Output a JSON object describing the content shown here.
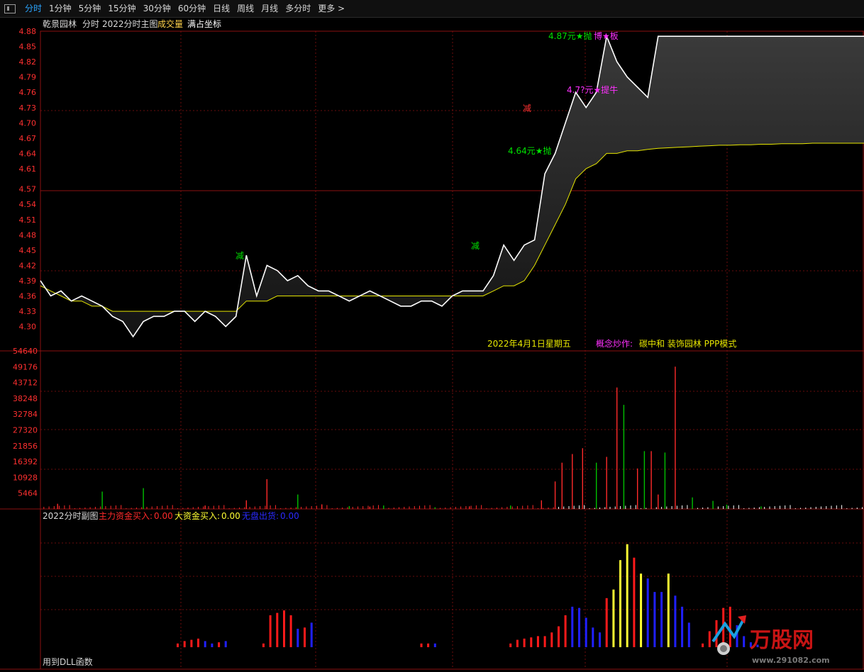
{
  "toolbar": {
    "menu_icon": "window-icon",
    "tabs": [
      "分时",
      "1分钟",
      "5分钟",
      "15分钟",
      "30分钟",
      "60分钟",
      "日线",
      "周线",
      "月线",
      "多分时",
      "更多 >"
    ],
    "active_index": 0
  },
  "chart_header": {
    "stock_name": "乾景园林",
    "period": "分时",
    "indicator": "2022分时主图",
    "volume_label": "成交量",
    "coord_mode": "满占坐标"
  },
  "annotations": {
    "date": "2022年4月1日星期五",
    "concept_label": "概念炒作:",
    "concept_text": "碳中和 装饰园林 PPP模式",
    "signals": [
      {
        "text": "减",
        "color": "#00e000"
      },
      {
        "text": "减",
        "color": "#00e000"
      },
      {
        "text": "4.64元★抛",
        "color": "#00e000"
      },
      {
        "text": "减",
        "color": "#ff3030"
      },
      {
        "text": "4.87元★抛",
        "color": "#00e000"
      },
      {
        "text": "博★板",
        "color": "#ff30ff"
      },
      {
        "text": "4.7?元★提牛",
        "color": "#ff30ff"
      }
    ]
  },
  "sub_chart": {
    "title": "2022分时副图",
    "main_in_label": "主力资金买入:",
    "main_in_value": "0.00",
    "big_in_label": "大资金买入:",
    "big_in_value": "0.00",
    "exit_label": "无盘出货:",
    "exit_value": "0.00",
    "footer": "用到DLL函数"
  },
  "watermark": {
    "brand": "万股网",
    "url": "www.291082.com"
  },
  "colors": {
    "up": "#ff2a2a",
    "down": "#00c000",
    "price": "#ffffff",
    "avg": "#e6e600",
    "grid": "#8a1010",
    "flat": "#ffffff",
    "yellow_bar": "#ffff33",
    "blue_bar": "#2020ff",
    "red_bar": "#ff1a1a"
  },
  "chart_data": [
    {
      "type": "line",
      "name": "price",
      "ylim": [
        4.28,
        4.88
      ],
      "yticks": [
        "4.88",
        "4.85",
        "4.82",
        "4.79",
        "4.76",
        "4.73",
        "4.70",
        "4.67",
        "4.64",
        "4.61",
        "4.57",
        "4.54",
        "4.51",
        "4.48",
        "4.45",
        "4.42",
        "4.39",
        "4.36",
        "4.33",
        "4.30"
      ],
      "x": [
        0,
        3,
        6,
        9,
        12,
        15,
        18,
        21,
        24,
        27,
        30,
        33,
        36,
        39,
        42,
        45,
        48,
        51,
        54,
        57,
        60,
        63,
        66,
        69,
        72,
        75,
        78,
        81,
        84,
        87,
        90,
        93,
        96,
        99,
        102,
        105,
        108,
        111,
        114,
        117,
        120,
        123,
        126,
        129,
        132,
        135,
        138,
        141,
        144,
        147,
        150,
        153,
        156,
        159,
        162,
        165,
        168,
        171,
        174,
        177,
        180,
        183,
        186,
        189,
        192,
        195,
        198,
        201,
        204,
        207,
        210,
        213,
        216,
        219,
        222,
        225,
        228,
        231,
        234,
        237,
        240
      ],
      "price": [
        4.39,
        4.36,
        4.37,
        4.35,
        4.36,
        4.35,
        4.34,
        4.32,
        4.31,
        4.28,
        4.31,
        4.32,
        4.32,
        4.33,
        4.33,
        4.31,
        4.33,
        4.32,
        4.3,
        4.32,
        4.44,
        4.36,
        4.42,
        4.41,
        4.39,
        4.4,
        4.38,
        4.37,
        4.37,
        4.36,
        4.35,
        4.36,
        4.37,
        4.36,
        4.35,
        4.34,
        4.34,
        4.35,
        4.35,
        4.34,
        4.36,
        4.37,
        4.37,
        4.37,
        4.4,
        4.46,
        4.43,
        4.46,
        4.47,
        4.6,
        4.64,
        4.7,
        4.76,
        4.73,
        4.76,
        4.87,
        4.82,
        4.79,
        4.77,
        4.75,
        4.87,
        4.87,
        4.87,
        4.87,
        4.87,
        4.87,
        4.87,
        4.87,
        4.87,
        4.87,
        4.87,
        4.87,
        4.87,
        4.87,
        4.87,
        4.87,
        4.87,
        4.87,
        4.87,
        4.87,
        4.87
      ],
      "avg": [
        4.38,
        4.37,
        4.36,
        4.35,
        4.35,
        4.34,
        4.34,
        4.33,
        4.33,
        4.33,
        4.33,
        4.33,
        4.33,
        4.33,
        4.33,
        4.33,
        4.33,
        4.33,
        4.33,
        4.33,
        4.35,
        4.35,
        4.35,
        4.36,
        4.36,
        4.36,
        4.36,
        4.36,
        4.36,
        4.36,
        4.36,
        4.36,
        4.36,
        4.36,
        4.36,
        4.36,
        4.36,
        4.36,
        4.36,
        4.36,
        4.36,
        4.36,
        4.36,
        4.36,
        4.37,
        4.38,
        4.38,
        4.39,
        4.42,
        4.46,
        4.5,
        4.54,
        4.59,
        4.61,
        4.62,
        4.64,
        4.64,
        4.645,
        4.645,
        4.648,
        4.65,
        4.651,
        4.652,
        4.653,
        4.654,
        4.655,
        4.656,
        4.656,
        4.657,
        4.657,
        4.658,
        4.658,
        4.659,
        4.659,
        4.659,
        4.66,
        4.66,
        4.66,
        4.66,
        4.66,
        4.66
      ]
    },
    {
      "type": "bar",
      "name": "volume",
      "ylim": [
        0,
        54640
      ],
      "yticks": [
        "54640",
        "49176",
        "43712",
        "38248",
        "32784",
        "27320",
        "21856",
        "16392",
        "10928",
        "5464"
      ],
      "x": [
        5,
        18,
        30,
        48,
        60,
        66,
        75,
        82,
        90,
        96,
        100,
        115,
        125,
        137,
        146,
        150,
        152,
        155,
        158,
        162,
        165,
        168,
        170,
        174,
        176,
        178,
        180,
        182,
        185,
        190,
        196,
        200,
        210
      ],
      "values": [
        1800,
        6000,
        7200,
        1200,
        3000,
        10300,
        5000,
        1600,
        1000,
        800,
        1200,
        600,
        900,
        1200,
        3000,
        9500,
        16000,
        19000,
        21000,
        16000,
        18000,
        42000,
        36000,
        14000,
        20000,
        20000,
        5000,
        19500,
        49200,
        4000,
        2800,
        1500,
        900
      ],
      "up": [
        true,
        false,
        false,
        true,
        true,
        true,
        false,
        true,
        false,
        true,
        false,
        false,
        true,
        false,
        true,
        true,
        true,
        true,
        true,
        false,
        true,
        true,
        false,
        true,
        false,
        true,
        true,
        false,
        true,
        false,
        false,
        false,
        false
      ]
    },
    {
      "type": "bar",
      "name": "2022分时副图",
      "x": [
        40,
        42,
        44,
        46,
        48,
        50,
        52,
        54,
        65,
        67,
        69,
        71,
        73,
        75,
        77,
        79,
        111,
        113,
        115,
        137,
        139,
        141,
        143,
        145,
        147,
        149,
        151,
        153,
        155,
        157,
        159,
        161,
        163,
        165,
        167,
        169,
        171,
        173,
        175,
        177,
        179,
        181,
        183,
        185,
        187,
        189,
        193,
        195,
        197,
        199,
        201,
        203,
        205,
        207,
        209
      ],
      "values": [
        0.03,
        0.05,
        0.06,
        0.07,
        0.05,
        0.03,
        0.04,
        0.05,
        0.03,
        0.26,
        0.28,
        0.3,
        0.26,
        0.15,
        0.16,
        0.2,
        0.03,
        0.03,
        0.03,
        0.03,
        0.06,
        0.07,
        0.08,
        0.09,
        0.09,
        0.12,
        0.17,
        0.26,
        0.33,
        0.32,
        0.24,
        0.16,
        0.12,
        0.4,
        0.47,
        0.71,
        0.84,
        0.73,
        0.6,
        0.56,
        0.45,
        0.45,
        0.6,
        0.42,
        0.33,
        0.2,
        0.03,
        0.13,
        0.22,
        0.32,
        0.33,
        0.18,
        0.09,
        0.04,
        0.02
      ],
      "colors": [
        "r",
        "r",
        "r",
        "r",
        "b",
        "b",
        "r",
        "b",
        "r",
        "r",
        "r",
        "r",
        "r",
        "b",
        "r",
        "b",
        "r",
        "r",
        "b",
        "r",
        "r",
        "r",
        "r",
        "r",
        "r",
        "r",
        "r",
        "r",
        "b",
        "b",
        "b",
        "b",
        "b",
        "r",
        "y",
        "y",
        "y",
        "r",
        "y",
        "b",
        "b",
        "b",
        "y",
        "b",
        "b",
        "b",
        "r",
        "r",
        "r",
        "r",
        "r",
        "b",
        "b",
        "b",
        "b"
      ]
    }
  ]
}
